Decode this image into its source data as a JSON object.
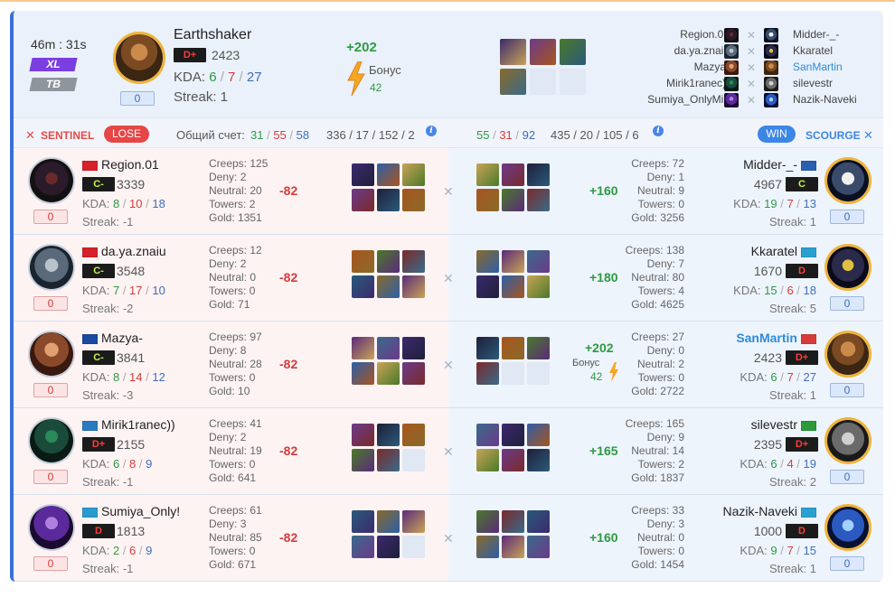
{
  "header": {
    "time": "46m : 31s",
    "badges": [
      "XL",
      "TB"
    ],
    "counter": "0",
    "hero_name": "Earthshaker",
    "rank": "D+",
    "mmr": "2423",
    "kda_label": "KDA:",
    "kda": [
      "6",
      "7",
      "27"
    ],
    "streak": "Streak: 1",
    "plus": "+202",
    "bonus_label": "Бонус",
    "bonus_value": "42",
    "roster_left": [
      "Region.01",
      "da.ya.znaiu",
      "Mazya-",
      "Mirik1ranec))",
      "Sumiya_OnlyMid"
    ],
    "roster_right": [
      "Midder-_-",
      "Kkaratel",
      "SanMartin",
      "silevestr",
      "Nazik-Naveki"
    ]
  },
  "teams": {
    "sentinel": "SENTINEL",
    "lose": "LOSE",
    "score_label": "Общий счет:",
    "left_score": [
      "31",
      "55",
      "58"
    ],
    "left_stats": "336 / 17 / 152 / 2",
    "right_score": [
      "55",
      "31",
      "92"
    ],
    "right_stats": "435 / 20 / 105 / 6",
    "win": "WIN",
    "scourge": "SCOURGE"
  },
  "labels": {
    "kda": "KDA:",
    "creeps": "Creeps:",
    "deny": "Deny:",
    "neutral": "Neutral:",
    "towers": "Towers:",
    "gold": "Gold:",
    "streak": "Streak:",
    "bonus": "Бонус"
  },
  "rows": [
    {
      "left": {
        "name": "Region.01",
        "rank": "C-",
        "mmr": "3339",
        "k": "8",
        "d": "10",
        "a": "18",
        "streak": "-1",
        "counter": "0",
        "creeps": "125",
        "deny": "2",
        "neutral": "20",
        "towers": "2",
        "gold": "1351",
        "delta": "-82"
      },
      "right": {
        "name": "Midder-_-",
        "rank": "C",
        "mmr": "4967",
        "k": "19",
        "d": "7",
        "a": "13",
        "streak": "1",
        "counter": "0",
        "creeps": "72",
        "deny": "1",
        "neutral": "9",
        "towers": "0",
        "gold": "3256",
        "delta": "+160"
      }
    },
    {
      "left": {
        "name": "da.ya.znaiu",
        "rank": "C-",
        "mmr": "3548",
        "k": "7",
        "d": "17",
        "a": "10",
        "streak": "-2",
        "counter": "0",
        "creeps": "12",
        "deny": "2",
        "neutral": "0",
        "towers": "0",
        "gold": "71",
        "delta": "-82"
      },
      "right": {
        "name": "Kkaratel",
        "rank": "D",
        "mmr": "1670",
        "k": "15",
        "d": "6",
        "a": "18",
        "streak": "5",
        "counter": "0",
        "creeps": "138",
        "deny": "7",
        "neutral": "80",
        "towers": "4",
        "gold": "4625",
        "delta": "+180"
      }
    },
    {
      "left": {
        "name": "Mazya-",
        "rank": "C-",
        "mmr": "3841",
        "k": "8",
        "d": "14",
        "a": "12",
        "streak": "-3",
        "counter": "0",
        "creeps": "97",
        "deny": "8",
        "neutral": "28",
        "towers": "0",
        "gold": "10",
        "delta": "-82"
      },
      "right": {
        "name": "SanMartin",
        "rank": "D+",
        "mmr": "2423",
        "k": "6",
        "d": "7",
        "a": "27",
        "streak": "1",
        "counter": "0",
        "creeps": "27",
        "deny": "0",
        "neutral": "2",
        "towers": "0",
        "gold": "2722",
        "delta": "+202",
        "bonus": "42"
      }
    },
    {
      "left": {
        "name": "Mirik1ranec))",
        "rank": "D+",
        "mmr": "2155",
        "k": "6",
        "d": "8",
        "a": "9",
        "streak": "-1",
        "counter": "0",
        "creeps": "41",
        "deny": "2",
        "neutral": "19",
        "towers": "0",
        "gold": "641",
        "delta": "-82"
      },
      "right": {
        "name": "silevestr",
        "rank": "D+",
        "mmr": "2395",
        "k": "6",
        "d": "4",
        "a": "19",
        "streak": "2",
        "counter": "0",
        "creeps": "165",
        "deny": "9",
        "neutral": "14",
        "towers": "2",
        "gold": "1837",
        "delta": "+165"
      }
    },
    {
      "left": {
        "name": "Sumiya_Only!",
        "rank": "D",
        "mmr": "1813",
        "k": "2",
        "d": "6",
        "a": "9",
        "streak": "-1",
        "counter": "0",
        "creeps": "61",
        "deny": "3",
        "neutral": "85",
        "towers": "0",
        "gold": "671",
        "delta": "-82"
      },
      "right": {
        "name": "Nazik-Naveki",
        "rank": "D",
        "mmr": "1000",
        "k": "9",
        "d": "7",
        "a": "15",
        "streak": "1",
        "counter": "0",
        "creeps": "33",
        "deny": "3",
        "neutral": "0",
        "towers": "0",
        "gold": "1454",
        "delta": "+160"
      }
    }
  ],
  "colors": {
    "accent_blue": "#3c86e6",
    "sentinel_red": "#e34b4b",
    "positive_green": "#2e9a43",
    "xl_purple": "#7b3ee0"
  },
  "icons": [
    "sentinel-icon",
    "scourge-icon",
    "lightning-bolt-icon",
    "versus-swords-icon",
    "info-icon"
  ]
}
